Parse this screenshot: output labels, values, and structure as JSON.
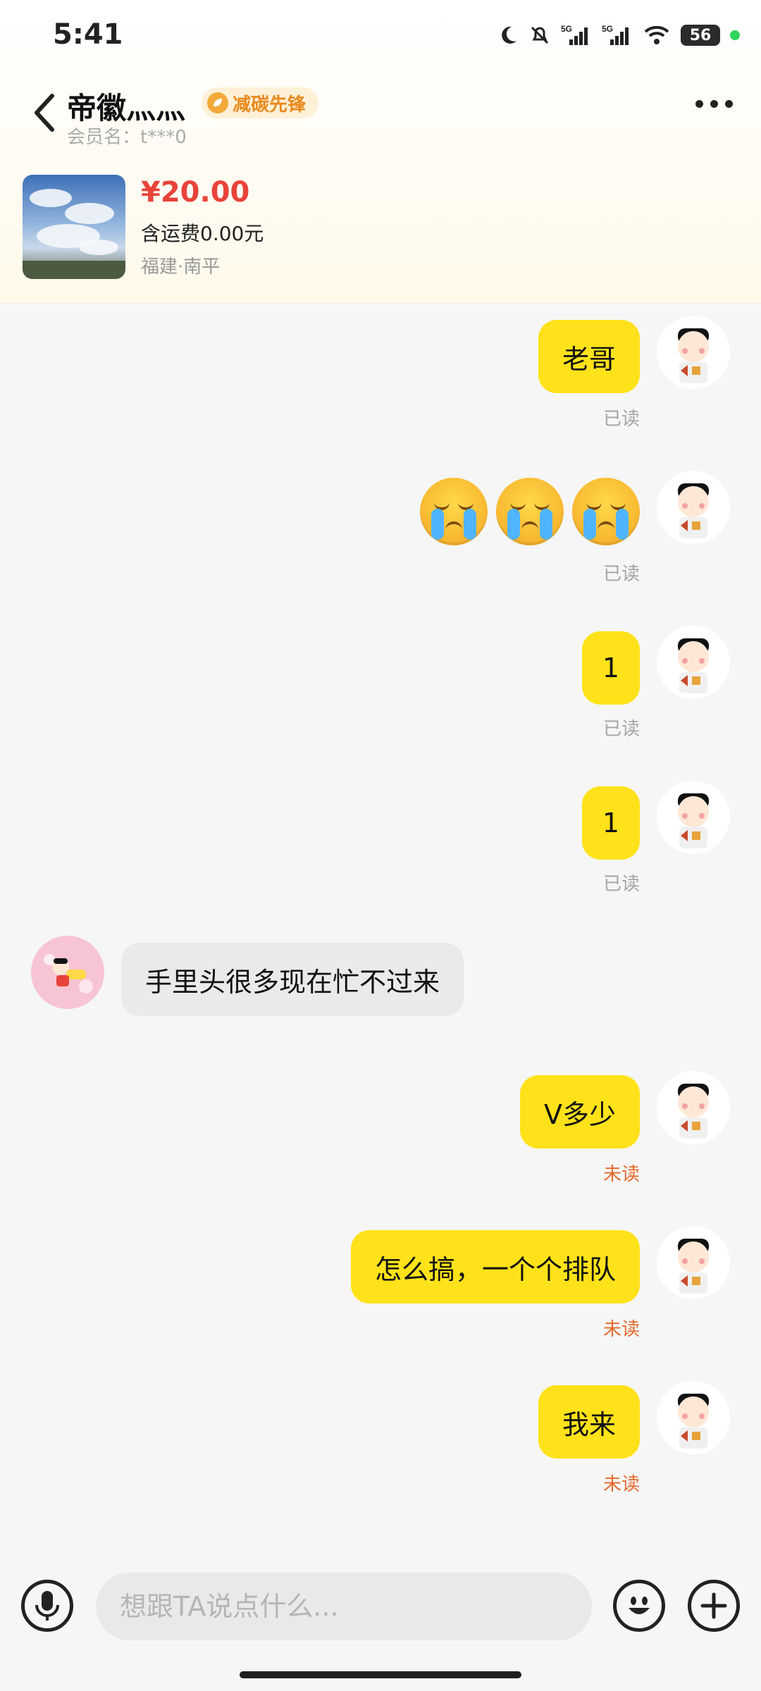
{
  "status_bar": {
    "time": "5:41",
    "network_1": "5G",
    "network_2": "5G",
    "battery": "56"
  },
  "header": {
    "name": "帝徽灬灬",
    "badge": "减碳先锋",
    "member": "会员名：t***0"
  },
  "product": {
    "price": "¥20.00",
    "shipping": "含运费0.00元",
    "location": "福建·南平"
  },
  "messages": [
    {
      "side": "right",
      "text": "老哥",
      "status": "已读"
    },
    {
      "side": "right",
      "type": "emoji",
      "emoji": "crying-face-icon",
      "count": 3,
      "status": "已读"
    },
    {
      "side": "right",
      "text": "1",
      "status": "已读"
    },
    {
      "side": "right",
      "text": "1",
      "status": "已读"
    },
    {
      "side": "left",
      "text": "手里头很多现在忙不过来"
    },
    {
      "side": "right",
      "text": "V多少",
      "status": "未读"
    },
    {
      "side": "right",
      "text": "怎么搞，一个个排队",
      "status": "未读"
    },
    {
      "side": "right",
      "text": "我来",
      "status": "未读"
    }
  ],
  "input": {
    "placeholder": "想跟TA说点什么..."
  },
  "colors": {
    "bubble_self": "#ffe219",
    "bubble_other": "#eaeaea",
    "price": "#e8433a",
    "read": "#a4a4a4",
    "unread": "#e46a2b",
    "badge": "#e8891b"
  }
}
